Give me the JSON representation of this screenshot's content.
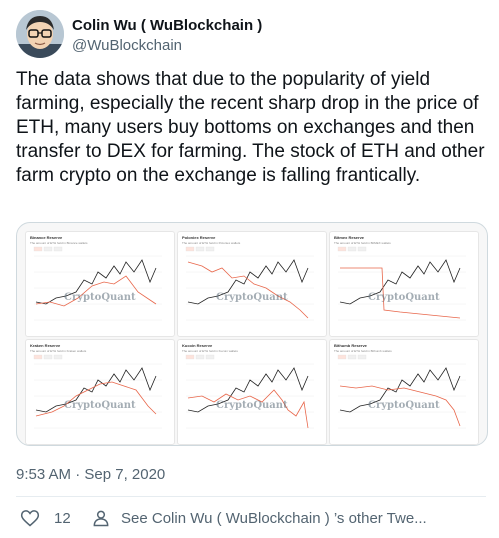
{
  "tweet": {
    "display_name": "Colin Wu ( WuBlockchain )",
    "handle": "@WuBlockchain",
    "text": "The data shows that due to the popularity of yield farming, especially the recent sharp drop in the price of ETH, many users buy bottoms on exchanges and then transfer to DEX for farming. The stock of ETH and other farm crypto on the exchange is falling frantically.",
    "timestamp": "9:53 AM · Sep 7, 2020",
    "likes": "12",
    "see_others": "See Colin Wu ( WuBlockchain ) ’s other Twe..."
  },
  "media": {
    "watermark": "CryptoQuant",
    "panels": [
      {
        "title": "Binance Reserve",
        "subtitle": "The amount of ETH held in Binance wallets"
      },
      {
        "title": "Poloniex Reserve",
        "subtitle": "The amount of ETH held in Poloniex wallets"
      },
      {
        "title": "Bitmex Reserve",
        "subtitle": "The amount of ETH held in BitMEX wallets"
      },
      {
        "title": "Kraken Reserve",
        "subtitle": "The amount of ETH held in Kraken wallets"
      },
      {
        "title": "Kucoin Reserve",
        "subtitle": "The amount of ETH held in Kucoin wallets"
      },
      {
        "title": "Bithumb Reserve",
        "subtitle": "The amount of ETH held in Bithumb wallets"
      }
    ]
  },
  "colors": {
    "reserve_line": "#e8664a",
    "price_line": "#222222",
    "secondary_text": "#536471"
  }
}
